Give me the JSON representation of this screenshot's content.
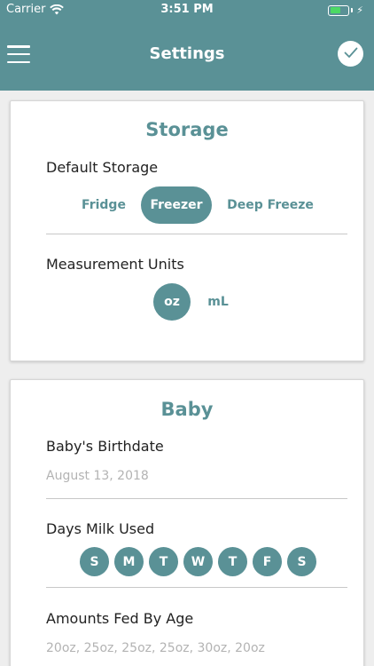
{
  "status_bar": {
    "carrier": "Carrier",
    "time": "3:51 PM"
  },
  "nav": {
    "title": "Settings",
    "menu_icon": "hamburger-menu-icon",
    "done_icon": "checkmark-icon"
  },
  "colors": {
    "accent": "#5a9196",
    "background": "#eeeeee",
    "card": "#ffffff",
    "muted_text": "#b3b3b3"
  },
  "storage": {
    "title": "Storage",
    "default_storage_label": "Default Storage",
    "storage_options": [
      "Fridge",
      "Freezer",
      "Deep Freeze"
    ],
    "storage_selected": "Freezer",
    "units_label": "Measurement Units",
    "unit_options": [
      "oz",
      "mL"
    ],
    "unit_selected": "oz"
  },
  "baby": {
    "title": "Baby",
    "birthdate_label": "Baby's Birthdate",
    "birthdate_value": "August 13, 2018",
    "days_label": "Days Milk Used",
    "days": [
      "S",
      "M",
      "T",
      "W",
      "T",
      "F",
      "S"
    ],
    "amounts_label": "Amounts Fed By Age",
    "amounts_value": "20oz, 25oz, 25oz, 25oz, 30oz, 20oz"
  }
}
